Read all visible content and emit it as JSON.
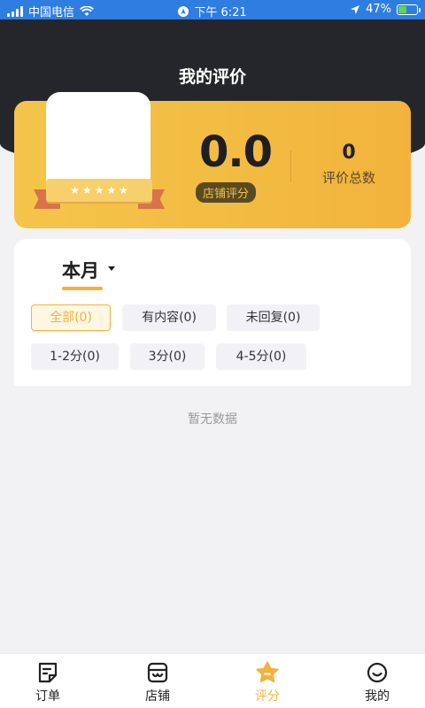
{
  "status_bar": {
    "carrier": "中国电信",
    "time": "下午 6:21",
    "battery": "47%",
    "battery_level": 0.47
  },
  "header": {
    "title": "我的评价"
  },
  "score_card": {
    "score": "0.0",
    "score_label": "店铺评分",
    "total_count": "0",
    "total_label": "评价总数",
    "stars": 5
  },
  "filter": {
    "period": "本月",
    "chips": [
      "全部(0)",
      "有内容(0)",
      "未回复(0)",
      "1-2分(0)",
      "3分(0)",
      "4-5分(0)"
    ],
    "active_index": 0
  },
  "empty_text": "暂无数据",
  "tabbar": {
    "items": [
      {
        "label": "订单",
        "icon": "order-icon"
      },
      {
        "label": "店铺",
        "icon": "store-icon"
      },
      {
        "label": "评分",
        "icon": "rating-icon"
      },
      {
        "label": "我的",
        "icon": "profile-icon"
      }
    ],
    "active_index": 2
  },
  "colors": {
    "accent": "#f2b33c",
    "header_bg": "#25262b",
    "status_bar": "#2f7de1"
  }
}
